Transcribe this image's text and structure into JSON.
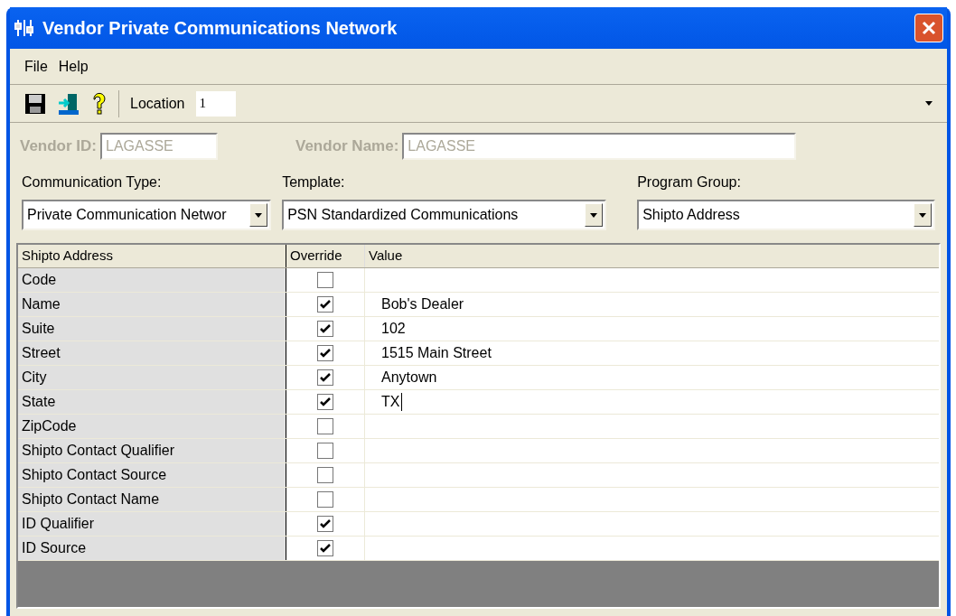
{
  "window": {
    "title": "Vendor Private Communications Network"
  },
  "menu": [
    "File",
    "Help"
  ],
  "toolbar": {
    "location_label": "Location",
    "location_value": "1"
  },
  "vendor": {
    "id_label": "Vendor ID:",
    "id_value": "LAGASSE",
    "name_label": "Vendor Name:",
    "name_value": "LAGASSE",
    "disabled": true
  },
  "selectors": [
    {
      "label": "Communication Type:",
      "value": "Private Communication Networ"
    },
    {
      "label": "Template:",
      "value": "PSN Standardized Communications"
    },
    {
      "label": "Program Group:",
      "value": "Shipto Address"
    }
  ],
  "table": {
    "columns": [
      "Shipto Address",
      "Override",
      "Value"
    ],
    "rows": [
      {
        "field": "Code",
        "checked": false,
        "value": ""
      },
      {
        "field": "Name",
        "checked": true,
        "value": "Bob's Dealer"
      },
      {
        "field": "Suite",
        "checked": true,
        "value": "102"
      },
      {
        "field": "Street",
        "checked": true,
        "value": "1515 Main Street"
      },
      {
        "field": "City",
        "checked": true,
        "value": "Anytown"
      },
      {
        "field": "State",
        "checked": true,
        "value": "TX",
        "editing": true
      },
      {
        "field": "ZipCode",
        "checked": false,
        "value": ""
      },
      {
        "field": "Shipto Contact Qualifier",
        "checked": false,
        "value": ""
      },
      {
        "field": "Shipto Contact Source",
        "checked": false,
        "value": ""
      },
      {
        "field": "Shipto Contact Name",
        "checked": false,
        "value": ""
      },
      {
        "field": "ID Qualifier",
        "checked": true,
        "value": ""
      },
      {
        "field": "ID Source",
        "checked": true,
        "value": ""
      }
    ]
  }
}
